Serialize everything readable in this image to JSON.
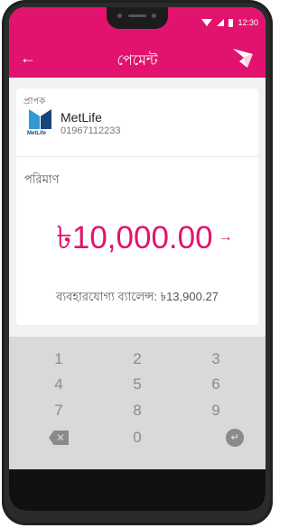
{
  "status_bar": {
    "time": "12:30"
  },
  "app_bar": {
    "back_icon": "arrow-left-icon",
    "title": "পেমেন্ট",
    "logo_icon": "bird-logo-icon"
  },
  "recipient": {
    "label": "প্রাপক",
    "logo_text": "MetLife",
    "name": "MetLife",
    "phone": "01967112233"
  },
  "amount": {
    "label": "পরিমাণ",
    "value": "৳10,000.00",
    "arrow": "→"
  },
  "balance": {
    "text": "ব্যবহারযোগ্য ব্যালেন্স: ৳13,900.27"
  },
  "keypad": {
    "keys": [
      "1",
      "2",
      "3",
      "4",
      "5",
      "6",
      "7",
      "8",
      "9",
      "0"
    ],
    "backspace_icon": "backspace-icon",
    "enter_icon": "enter-icon"
  },
  "colors": {
    "brand": "#e2136e",
    "keypad_bg": "#d9d9dc"
  }
}
